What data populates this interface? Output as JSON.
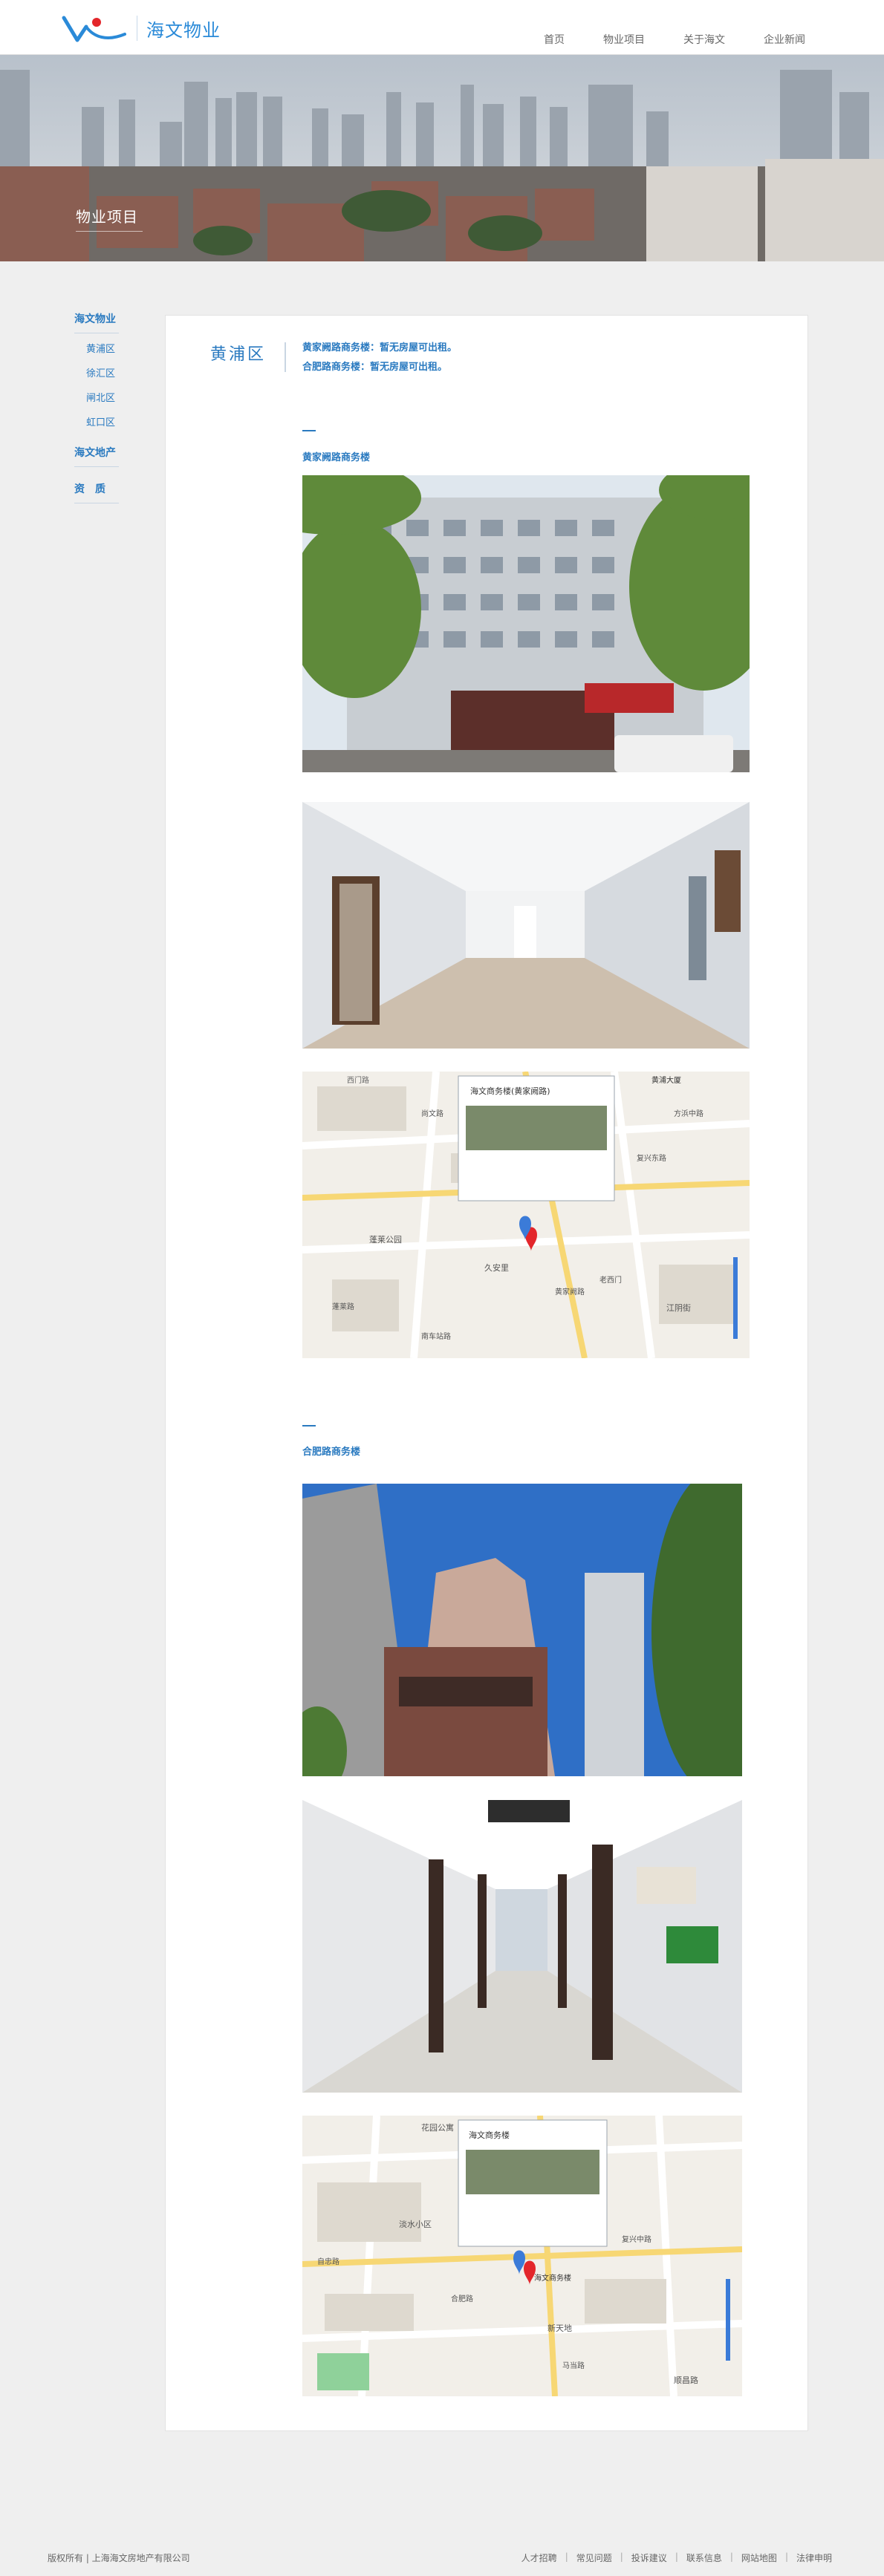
{
  "header": {
    "logo_text": "海文物业",
    "nav": [
      "首页",
      "物业项目",
      "关于海文",
      "企业新闻"
    ]
  },
  "banner": {
    "title": "物业项目"
  },
  "sidebar": {
    "groups": [
      {
        "label": "海文物业",
        "children": [
          "黄浦区",
          "徐汇区",
          "闸北区",
          "虹口区"
        ]
      },
      {
        "label": "海文地产",
        "children": []
      },
      {
        "label": "资　质",
        "children": []
      }
    ]
  },
  "content": {
    "district": "黄浦区",
    "status_lines": [
      "黄家阙路商务楼：暂无房屋可出租。",
      "合肥路商务楼：暂无房屋可出租。"
    ],
    "sections": [
      {
        "title": "黄家阙路商务楼"
      },
      {
        "title": "合肥路商务楼"
      }
    ],
    "map1": {
      "popup_title": "海文商务楼(黄家阙路)",
      "marker_label": "黄浦大厦",
      "place_labels": [
        "西门路",
        "蓬莱公园",
        "久安里",
        "老西门",
        "复兴东路",
        "蓬莱路",
        "尚文路",
        "黄家阙路",
        "江阴街",
        "南车站路",
        "方浜中路"
      ]
    },
    "map2": {
      "popup_title": "海文商务楼",
      "marker_label": "海文商务楼",
      "place_labels": [
        "花园公寓",
        "淡水小区",
        "新天地",
        "复兴中路",
        "合肥路",
        "马当路",
        "自忠路",
        "顺昌路"
      ]
    }
  },
  "footer": {
    "copyright": "版权所有 | 上海海文房地产有限公司",
    "links": [
      "人才招聘",
      "常见问题",
      "投诉建议",
      "联系信息",
      "网站地图",
      "法律申明"
    ]
  },
  "colors": {
    "accent": "#2a7ac0",
    "logo_blue": "#2a8ad8",
    "logo_red": "#e3262b",
    "page_bg": "#efefef"
  }
}
